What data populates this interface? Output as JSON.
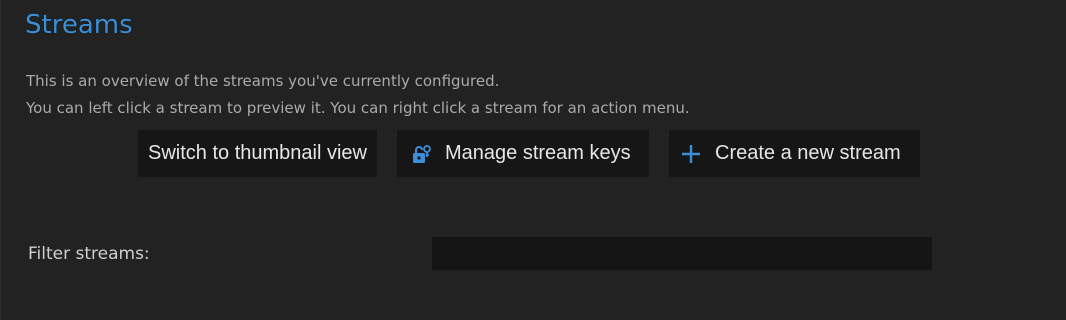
{
  "page": {
    "title": "Streams",
    "description_line1": "This is an overview of the streams you've currently configured.",
    "description_line2": "You can left click a stream to preview it. You can right click a stream for an action menu."
  },
  "toolbar": {
    "thumbnail_label": "Switch to thumbnail view",
    "keys_label": "Manage stream keys",
    "keys_icon": "lock-key-icon",
    "create_label": "Create a new stream",
    "create_icon": "plus-icon"
  },
  "filter": {
    "label": "Filter streams:",
    "value": "",
    "placeholder": ""
  },
  "colors": {
    "background": "#222222",
    "accent": "#3a8fd6",
    "button_bg": "#161616",
    "input_bg": "#141414"
  }
}
